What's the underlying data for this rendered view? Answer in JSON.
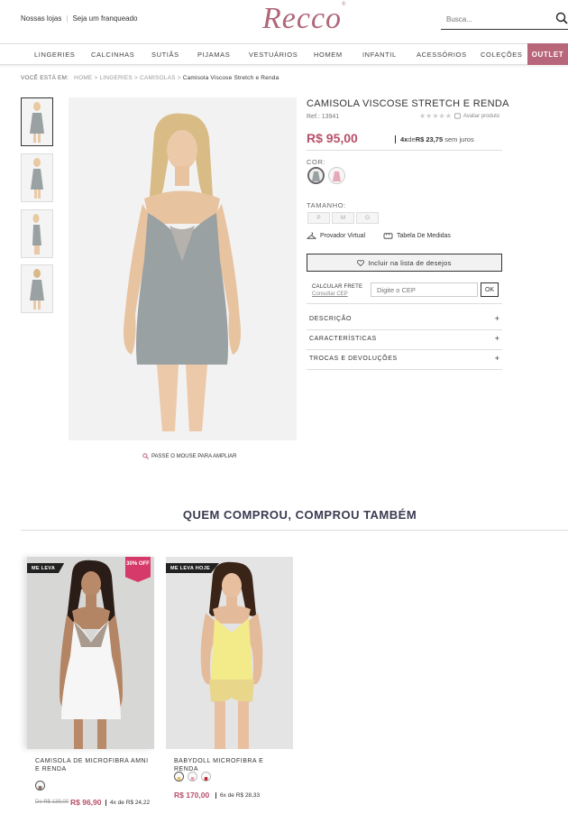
{
  "header": {
    "store_link": "Nossas lojas",
    "franchise_link": "Seja um franqueado",
    "logo": "Recco",
    "logo_mark": "®",
    "search_placeholder": "Busca..."
  },
  "nav": {
    "items": [
      "LINGERIES",
      "CALCINHAS",
      "SUTIÃS",
      "PIJAMAS",
      "VESTUÁRIOS",
      "HOMEM",
      "INFANTIL",
      "ACESSÓRIOS",
      "COLEÇÕES"
    ],
    "outlet": "OUTLET"
  },
  "breadcrumb": {
    "lead": "VOCÊ ESTÁ EM:",
    "path": "HOME > LINGERIES > CAMISOLAS > ",
    "current": "Camisola Viscose Stretch e Renda"
  },
  "product": {
    "title": "CAMISOLA VISCOSE STRETCH E RENDA",
    "ref": "Ref.: 13941",
    "rating_stars": "★★★★★",
    "rating_link": "Avaliar produto",
    "price": "R$ 95,00",
    "install_count": "4x",
    "install_de": "de",
    "install_value": "R$ 23,75",
    "install_suffix": " sem juros",
    "color_label": "COR:",
    "size_label": "TAMANHO:",
    "sizes": [
      "P",
      "M",
      "G"
    ],
    "virtual_fitting": "Provador Virtual",
    "size_chart": "Tabela De Medidas",
    "wishlist": "Incluir na lista de desejos",
    "shipping_label": "CALCULAR FRETE",
    "shipping_link": "Consultar CEP",
    "cep_placeholder": "Digite o CEP",
    "cep_button": "OK",
    "zoom_hint": "PASSE O MOUSE PARA AMPLIAR",
    "accordions": [
      "DESCRIÇÃO",
      "CARACTERÍSTICAS",
      "TROCAS E DEVOLUÇÕES"
    ],
    "accordion_icon": "+"
  },
  "related": {
    "title": "QUEM COMPROU, COMPROU TAMBÉM",
    "cards": [
      {
        "tag": "ME LEVA",
        "discount": "30% OFF",
        "name": "CAMISOLA DE MICROFIBRA AMNI E RENDA",
        "old_price": "De R$ 139,00",
        "price": "R$ 96,90",
        "install": "4x de R$ 24,22"
      },
      {
        "tag": "ME LEVA HOJE",
        "name": "BABYDOLL MICROFIBRA E RENDA",
        "price": "R$ 170,00",
        "install": "6x de R$ 28,33"
      }
    ]
  },
  "colors": {
    "brand": "#b0677a",
    "price": "#b8506a",
    "outlet_bg": "#b8677b",
    "discount_tag": "#d63a6a",
    "related_title": "#3a3a52",
    "dress_gray": "#9aa1a3"
  }
}
